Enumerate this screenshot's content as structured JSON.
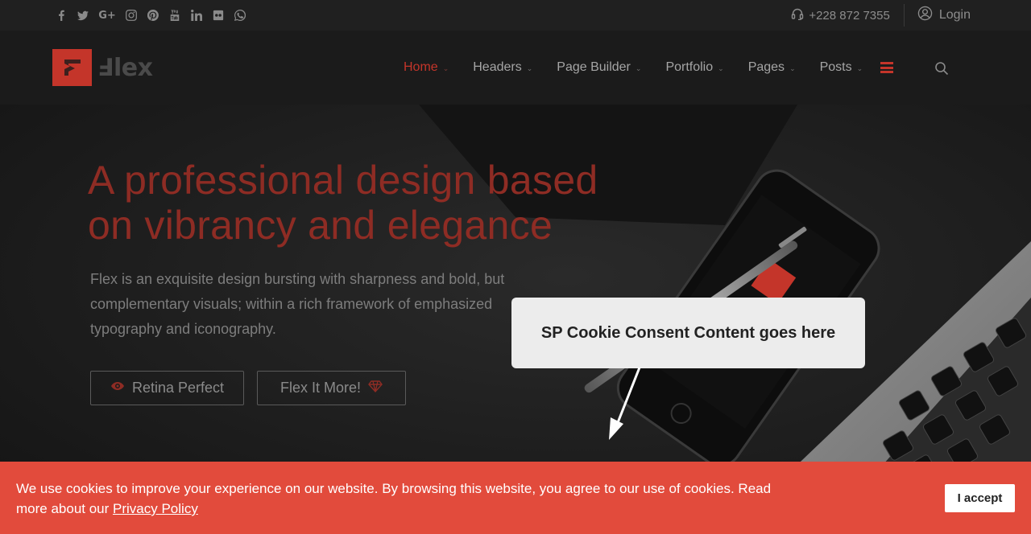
{
  "topbar": {
    "social_icons": [
      "facebook-icon",
      "twitter-icon",
      "google-plus-icon",
      "instagram-icon",
      "pinterest-icon",
      "youtube-icon",
      "linkedin-icon",
      "flickr-icon",
      "whatsapp-icon"
    ],
    "phone": "+228 872 7355",
    "login": "Login"
  },
  "brand": {
    "name": "lex"
  },
  "nav": {
    "items": [
      {
        "label": "Home",
        "active": true
      },
      {
        "label": "Headers",
        "active": false
      },
      {
        "label": "Page Builder",
        "active": false
      },
      {
        "label": "Portfolio",
        "active": false
      },
      {
        "label": "Pages",
        "active": false
      },
      {
        "label": "Posts",
        "active": false
      }
    ]
  },
  "hero": {
    "headline": "A professional design based on vibrancy and elegance",
    "subtext": "Flex is an exquisite design bursting with sharpness and bold, but complementary visuals; within a rich framework of emphasized typography and iconography.",
    "button1": "Retina Perfect",
    "button2": "Flex It More!"
  },
  "callout": {
    "text": "SP Cookie Consent Content goes here"
  },
  "cookie": {
    "message": "We use cookies to improve your experience on our website. By browsing this website, you agree to our use of cookies. Read more about our ",
    "link": "Privacy Policy",
    "accept": "I accept"
  },
  "colors": {
    "accent": "#c4352a",
    "cookie_bar": "#e24b3c"
  }
}
